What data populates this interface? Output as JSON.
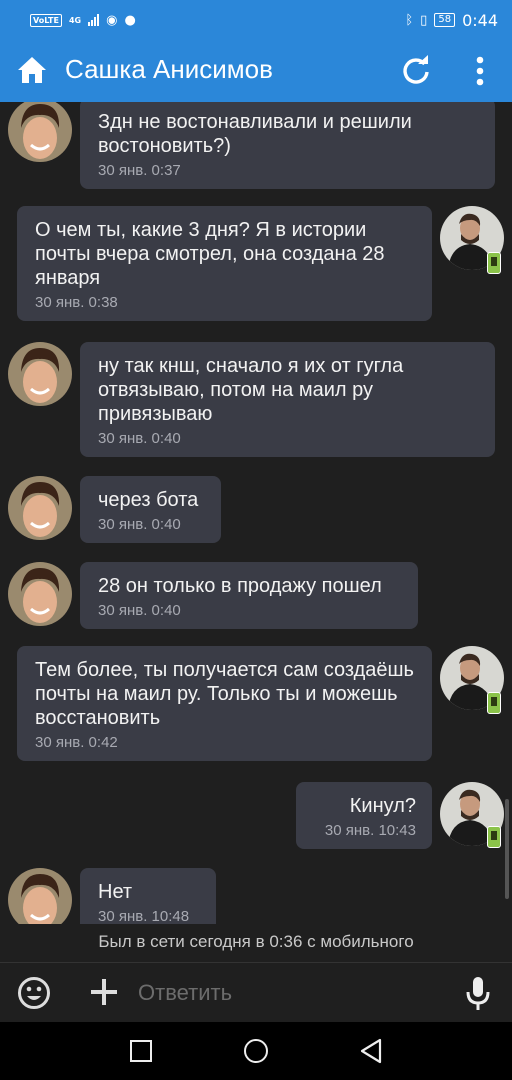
{
  "status_bar": {
    "volte": "VoLTE",
    "network": "4G",
    "battery": "58",
    "time": "0:44"
  },
  "header": {
    "title": "Сашка Анисимов"
  },
  "messages": [
    {
      "side": "left",
      "text": "Здн не востонавливали и решили востоновить?)",
      "time": "30 янв. 0:37"
    },
    {
      "side": "right",
      "text": "О чем ты, какие 3 дня? Я в истории почты вчера смотрел, она создана 28 января",
      "time": "30 янв. 0:38"
    },
    {
      "side": "left",
      "text": "ну так кнш, сначало я их от гугла отвязываю, потом на маил ру привязываю",
      "time": "30 янв. 0:40"
    },
    {
      "side": "left",
      "text": "через бота",
      "time": "30 янв. 0:40"
    },
    {
      "side": "left",
      "text": "28 он только в продажу пошел",
      "time": "30 янв. 0:40"
    },
    {
      "side": "right",
      "text": "Тем более, ты получается сам создаёшь почты на маил ру. Только ты и можешь восстановить",
      "time": "30 янв. 0:42"
    },
    {
      "side": "right",
      "text": "Кинул?",
      "time": "30 янв. 10:43"
    },
    {
      "side": "left",
      "text": "Нет",
      "time": "30 янв. 10:48"
    }
  ],
  "last_seen": "Был в сети сегодня в 0:36 с мобильного",
  "input": {
    "placeholder": "Ответить"
  },
  "icons": {
    "home": "home-icon",
    "refresh": "refresh-icon",
    "menu": "more-vert-icon",
    "emoji": "emoji-icon",
    "attach": "plus-icon",
    "mic": "mic-icon"
  },
  "colors": {
    "accent": "#2b87d9",
    "background": "#1f1f1f",
    "bubble": "#3a3c46",
    "online_badge": "#8bc34a"
  }
}
